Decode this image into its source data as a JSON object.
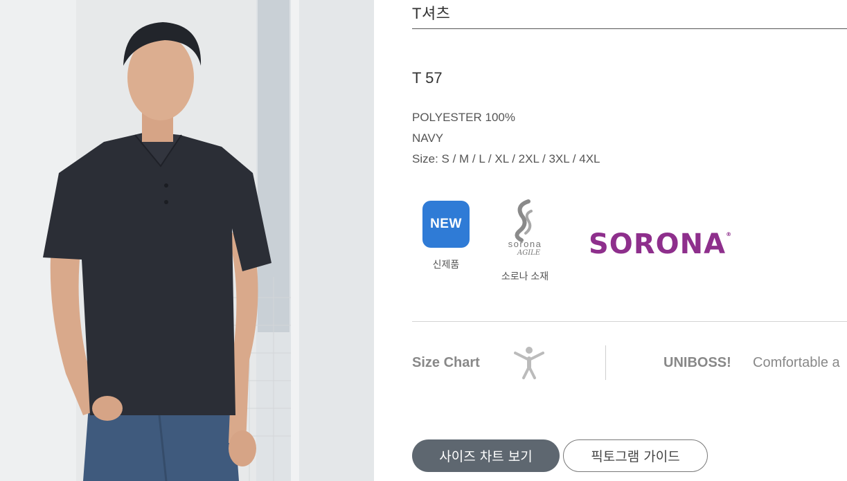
{
  "category": "T셔츠",
  "model": "T 57",
  "specs": {
    "material": "POLYESTER 100%",
    "color": "NAVY",
    "size": "Size: S / M / L / XL / 2XL / 3XL / 4XL"
  },
  "badges": {
    "new_label": "NEW",
    "new_caption": "신제품",
    "sorona_small": "sorona",
    "sorona_agile": "AGILE",
    "sorona_caption": "소로나 소재",
    "new_color": "#2f7bd6"
  },
  "brand_logo": {
    "text": "SORONA",
    "mark": "®",
    "color": "#8e2f8c"
  },
  "size_chart": {
    "label": "Size Chart",
    "icon": "person-icon",
    "brand": "UNIBOSS!",
    "tagline": "Comfortable a"
  },
  "buttons": {
    "size_chart": "사이즈 차트 보기",
    "pictogram_guide": "픽토그램 가이드"
  },
  "colors": {
    "shirt": "#2b2e36",
    "primary_button": "#5e6770"
  }
}
